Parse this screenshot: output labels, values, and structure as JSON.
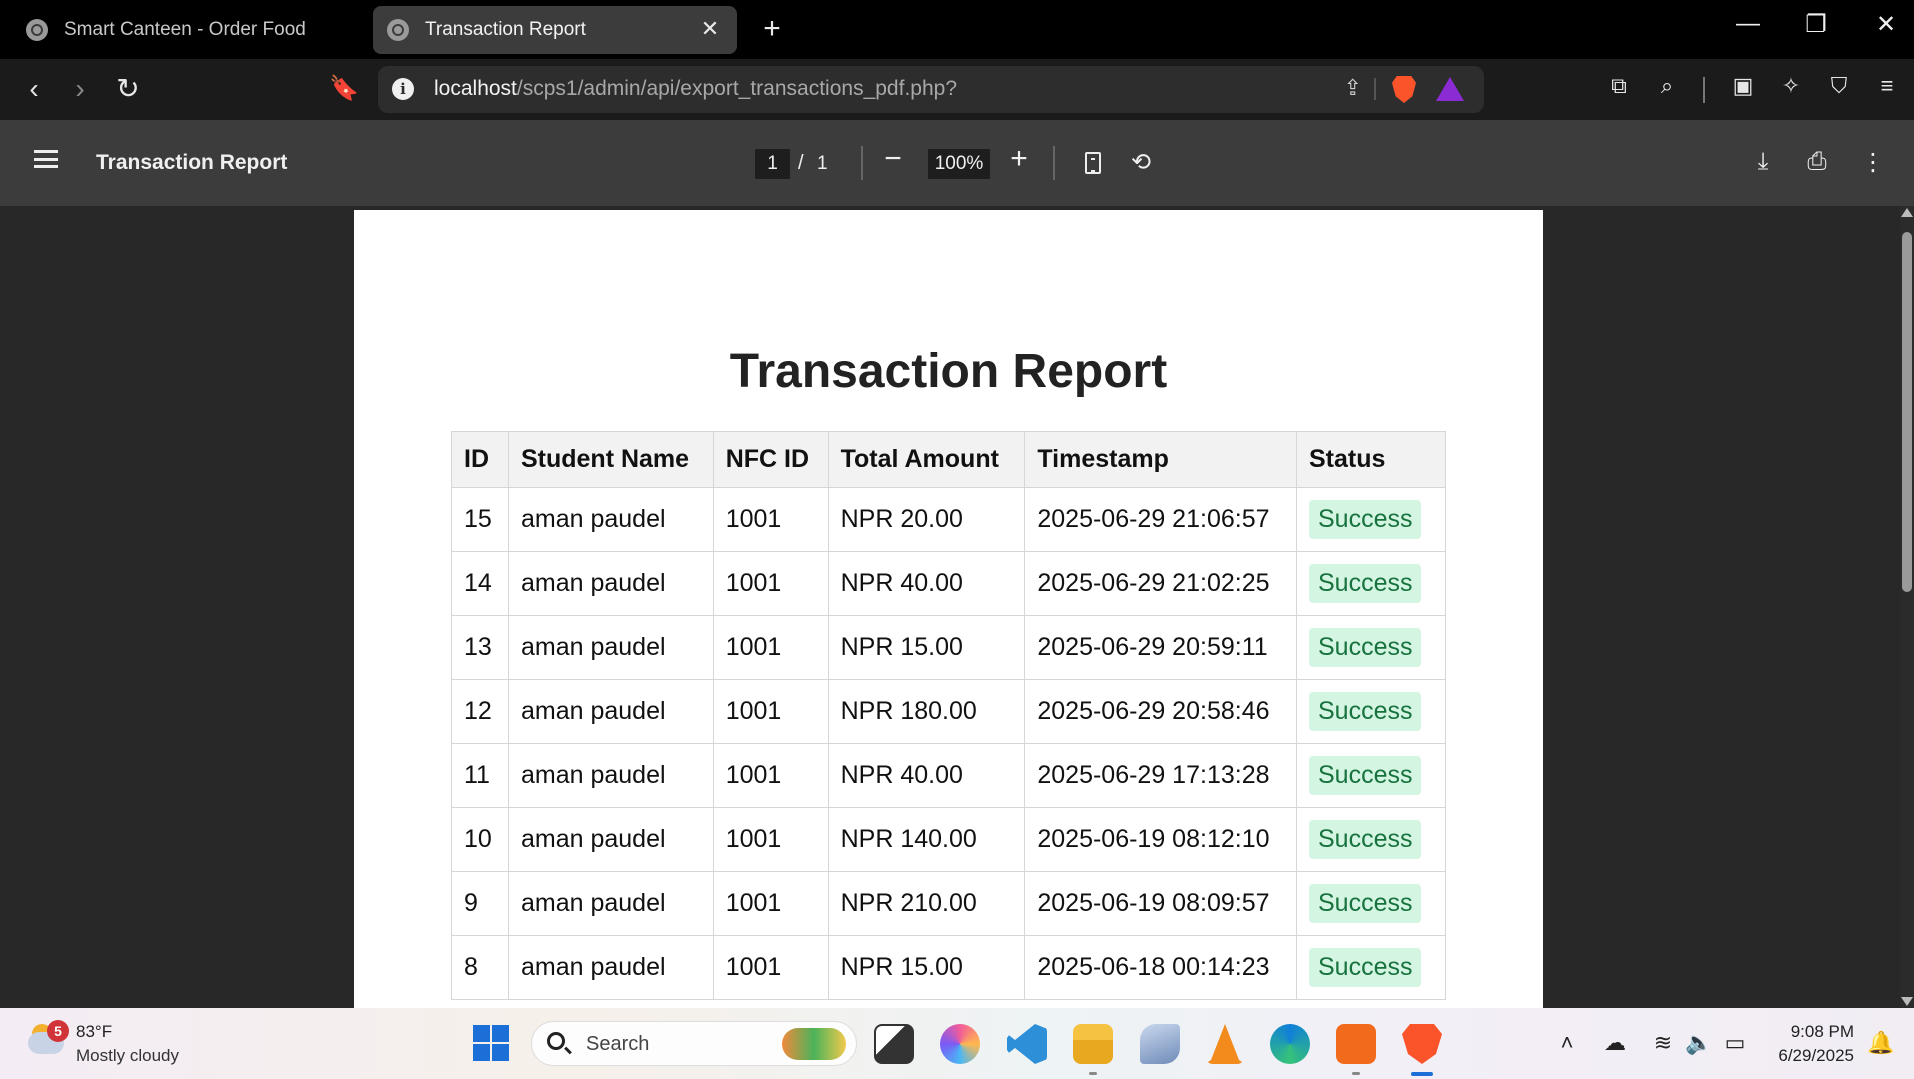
{
  "tabs": [
    {
      "title": "Smart Canteen - Order Food",
      "active": false
    },
    {
      "title": "Transaction Report",
      "active": true
    }
  ],
  "address_bar": {
    "host": "localhost",
    "path": "/scps1/admin/api/export_transactions_pdf.php?"
  },
  "pdf_viewer": {
    "title": "Transaction Report",
    "current_page": "1",
    "page_separator": "/",
    "total_pages": "1",
    "zoom": "100%"
  },
  "report": {
    "title": "Transaction Report",
    "columns": [
      "ID",
      "Student Name",
      "NFC ID",
      "Total Amount",
      "Timestamp",
      "Status"
    ],
    "rows": [
      {
        "id": "15",
        "name": "aman paudel",
        "nfc": "1001",
        "amount": "NPR 20.00",
        "timestamp": "2025-06-29 21:06:57",
        "status": "Success"
      },
      {
        "id": "14",
        "name": "aman paudel",
        "nfc": "1001",
        "amount": "NPR 40.00",
        "timestamp": "2025-06-29 21:02:25",
        "status": "Success"
      },
      {
        "id": "13",
        "name": "aman paudel",
        "nfc": "1001",
        "amount": "NPR 15.00",
        "timestamp": "2025-06-29 20:59:11",
        "status": "Success"
      },
      {
        "id": "12",
        "name": "aman paudel",
        "nfc": "1001",
        "amount": "NPR 180.00",
        "timestamp": "2025-06-29 20:58:46",
        "status": "Success"
      },
      {
        "id": "11",
        "name": "aman paudel",
        "nfc": "1001",
        "amount": "NPR 40.00",
        "timestamp": "2025-06-29 17:13:28",
        "status": "Success"
      },
      {
        "id": "10",
        "name": "aman paudel",
        "nfc": "1001",
        "amount": "NPR 140.00",
        "timestamp": "2025-06-19 08:12:10",
        "status": "Success"
      },
      {
        "id": "9",
        "name": "aman paudel",
        "nfc": "1001",
        "amount": "NPR 210.00",
        "timestamp": "2025-06-19 08:09:57",
        "status": "Success"
      },
      {
        "id": "8",
        "name": "aman paudel",
        "nfc": "1001",
        "amount": "NPR 15.00",
        "timestamp": "2025-06-18 00:14:23",
        "status": "Success"
      }
    ]
  },
  "taskbar": {
    "weather_badge": "5",
    "weather_temp": "83°F",
    "weather_desc": "Mostly cloudy",
    "search_label": "Search",
    "time": "9:08 PM",
    "date": "6/29/2025"
  },
  "colors": {
    "status_success_bg": "#d5f5e3",
    "status_success_text": "#17733e",
    "brave_orange": "#fb542b",
    "windows_blue": "#1c6fd6"
  }
}
